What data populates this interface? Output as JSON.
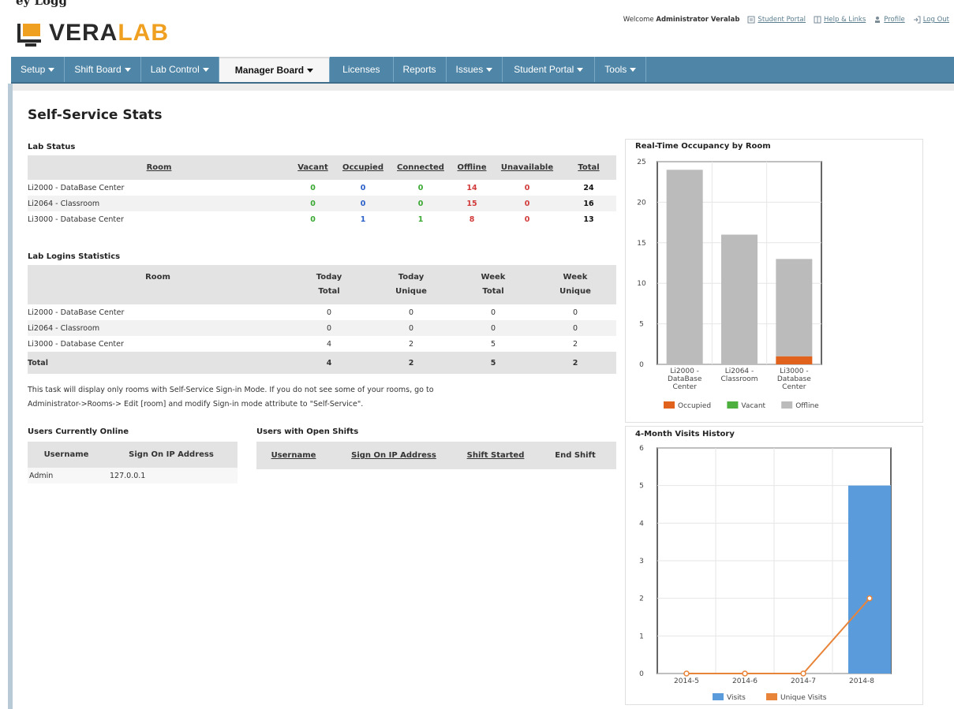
{
  "top_cut_text": "ey Logg",
  "brand": {
    "vera": "VERA",
    "lab": "LAB"
  },
  "header": {
    "welcome_prefix": "Welcome",
    "user": "Administrator Veralab",
    "links": [
      {
        "label": "Student Portal",
        "icon": "portal-icon"
      },
      {
        "label": "Help & Links",
        "icon": "book-icon"
      },
      {
        "label": "Profile",
        "icon": "user-icon"
      },
      {
        "label": "Log Out",
        "icon": "logout-icon"
      }
    ]
  },
  "nav": [
    {
      "label": "Setup",
      "caret": true
    },
    {
      "label": "Shift Board",
      "caret": true
    },
    {
      "label": "Lab Control",
      "caret": true
    },
    {
      "label": "Manager Board",
      "caret": true,
      "active": true
    },
    {
      "label": "Licenses",
      "caret": false
    },
    {
      "label": "Reports",
      "caret": false
    },
    {
      "label": "Issues",
      "caret": true
    },
    {
      "label": "Student Portal",
      "caret": true
    },
    {
      "label": "Tools",
      "caret": true
    }
  ],
  "page_title": "Self-Service Stats",
  "lab_status": {
    "title": "Lab Status",
    "headers": [
      "Room",
      "Vacant",
      "Occupied",
      "Connected",
      "Offline",
      "Unavailable",
      "Total"
    ],
    "rows": [
      [
        "Li2000 - DataBase Center",
        "0",
        "0",
        "0",
        "14",
        "0",
        "24"
      ],
      [
        "Li2064 - Classroom",
        "0",
        "0",
        "0",
        "15",
        "0",
        "16"
      ],
      [
        "Li3000 - Database Center",
        "0",
        "1",
        "1",
        "8",
        "0",
        "13"
      ]
    ]
  },
  "lab_logins": {
    "title": "Lab Logins Statistics",
    "headers": [
      "Room",
      "Today Total",
      "Today Unique",
      "Week Total",
      "Week Unique"
    ],
    "header_lines": [
      [
        "Room"
      ],
      [
        "Today",
        "Total"
      ],
      [
        "Today",
        "Unique"
      ],
      [
        "Week",
        "Total"
      ],
      [
        "Week",
        "Unique"
      ]
    ],
    "rows": [
      [
        "Li2000 - DataBase Center",
        "0",
        "0",
        "0",
        "0"
      ],
      [
        "Li2064 - Classroom",
        "0",
        "0",
        "0",
        "0"
      ],
      [
        "Li3000 - Database Center",
        "4",
        "2",
        "5",
        "2"
      ]
    ],
    "total_row": [
      "Total",
      "4",
      "2",
      "5",
      "2"
    ]
  },
  "note_line1": "This task will display only rooms with Self-Service Sign-in Mode. If you do not see some of your rooms, go to",
  "note_line2": "Administrator->Rooms-> Edit [room] and modify Sign-in mode attribute to \"Self-Service\".",
  "users_online": {
    "title": "Users Currently Online",
    "headers": [
      "Username",
      "Sign On IP Address"
    ],
    "rows": [
      [
        "Admin",
        "127.0.0.1"
      ]
    ]
  },
  "open_shifts": {
    "title": "Users with Open Shifts",
    "headers": [
      "Username",
      "Sign On IP Address",
      "Shift Started",
      "End Shift"
    ]
  },
  "colors": {
    "nav": "#4f86a7",
    "green": "#3aa832",
    "blue": "#2a5fc9",
    "red": "#d23a3a",
    "occupied": "#e0621c",
    "vacant": "#4caf3e",
    "offline": "#bbbbbb",
    "visits": "#5a9bdc",
    "unique": "#e8843a"
  },
  "chart_data": [
    {
      "type": "bar",
      "stacked": true,
      "title": "Real-Time Occupancy by Room",
      "categories": [
        "Li2000 - DataBase Center",
        "Li2064 - Classroom",
        "Li3000 - Database Center"
      ],
      "category_lines": [
        [
          "Li2000 -",
          "DataBase",
          "Center"
        ],
        [
          "Li2064 -",
          "Classroom"
        ],
        [
          "Li3000 -",
          "Database",
          "Center"
        ]
      ],
      "series": [
        {
          "name": "Occupied",
          "values": [
            0,
            0,
            1
          ]
        },
        {
          "name": "Vacant",
          "values": [
            0,
            0,
            0
          ]
        },
        {
          "name": "Offline",
          "values": [
            24,
            16,
            12
          ]
        }
      ],
      "ylim": [
        0,
        25
      ],
      "yticks": [
        0,
        5,
        10,
        15,
        20,
        25
      ],
      "grid": true,
      "legend": "bottom"
    },
    {
      "type": "bar",
      "title": "4-Month Visits History",
      "categories": [
        "2014-5",
        "2014-6",
        "2014-7",
        "2014-8"
      ],
      "series": [
        {
          "name": "Visits",
          "type": "bar",
          "values": [
            0,
            0,
            0,
            5
          ]
        },
        {
          "name": "Unique Visits",
          "type": "line",
          "values": [
            0,
            0,
            0,
            2
          ]
        }
      ],
      "ylim": [
        0,
        6
      ],
      "yticks": [
        0,
        1,
        2,
        3,
        4,
        5,
        6
      ],
      "grid": true,
      "legend": "bottom"
    }
  ]
}
